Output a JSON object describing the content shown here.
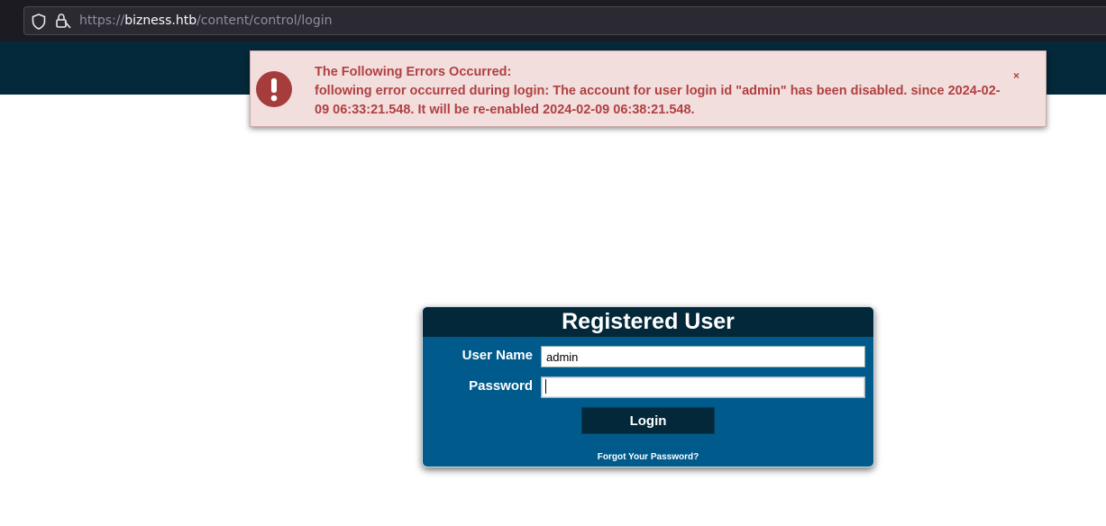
{
  "browser": {
    "url_host": "bizness.htb",
    "url_prefix": "https://",
    "url_path": "/content/control/login",
    "icons": [
      "shield-icon",
      "lock-icon"
    ]
  },
  "error": {
    "heading": "The Following Errors Occurred:",
    "message": "following error occurred during login: The account for user login id \"admin\" has been disabled. since 2024-02-09 06:33:21.548. It will be re-enabled 2024-02-09 06:38:21.548.",
    "close_label": "×",
    "icon": "exclamation-icon",
    "color": "#b04040",
    "background": "#f3dede"
  },
  "login": {
    "title": "Registered User",
    "username_label": "User Name",
    "username_value": "admin",
    "password_label": "Password",
    "password_value": "",
    "button_label": "Login",
    "forgot_link": "Forgot Your Password?",
    "panel_color": "#005b8c",
    "header_color": "#032839"
  }
}
